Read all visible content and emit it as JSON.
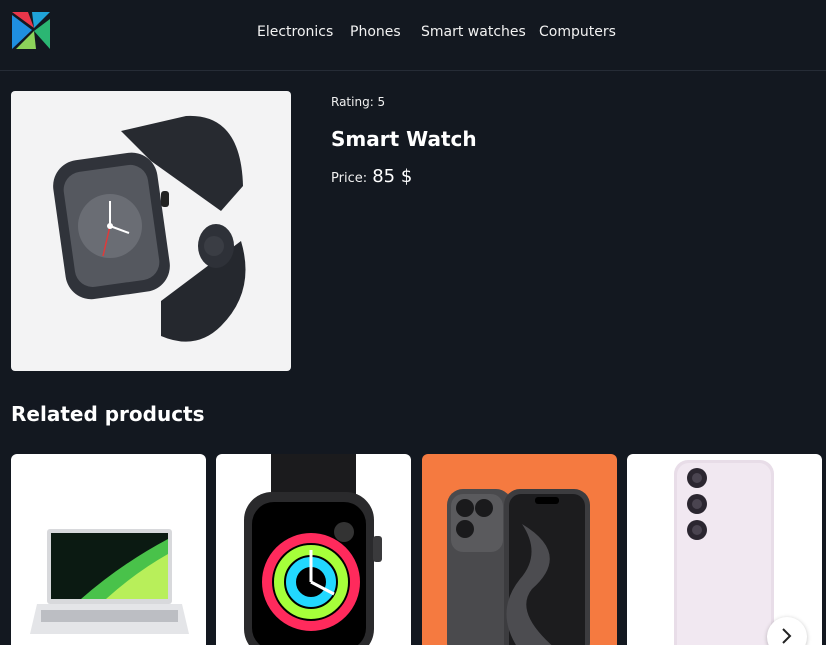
{
  "header": {
    "logo_icon": "pinwheel-logo-icon",
    "nav": [
      {
        "label": "Electronics"
      },
      {
        "label": "Phones"
      },
      {
        "label": "Smart watches"
      },
      {
        "label": "Computers"
      }
    ]
  },
  "product": {
    "image_icon": "smartwatch-image",
    "rating_label": "Rating: 5",
    "title": "Smart Watch",
    "price_label": "Price:",
    "price_value": "85 $"
  },
  "related": {
    "title": "Related products",
    "items": [
      {
        "image": "laptop-image",
        "bg": "#ffffff"
      },
      {
        "image": "smartwatch-image",
        "bg": "#ffffff"
      },
      {
        "image": "smartphone-image",
        "bg": "#f57a40"
      },
      {
        "image": "smartphone-image",
        "bg": "#ffffff"
      }
    ],
    "next_icon": "chevron-right-icon"
  },
  "colors": {
    "background": "#131820",
    "text": "#ffffff",
    "card_accent": "#f57a40"
  }
}
